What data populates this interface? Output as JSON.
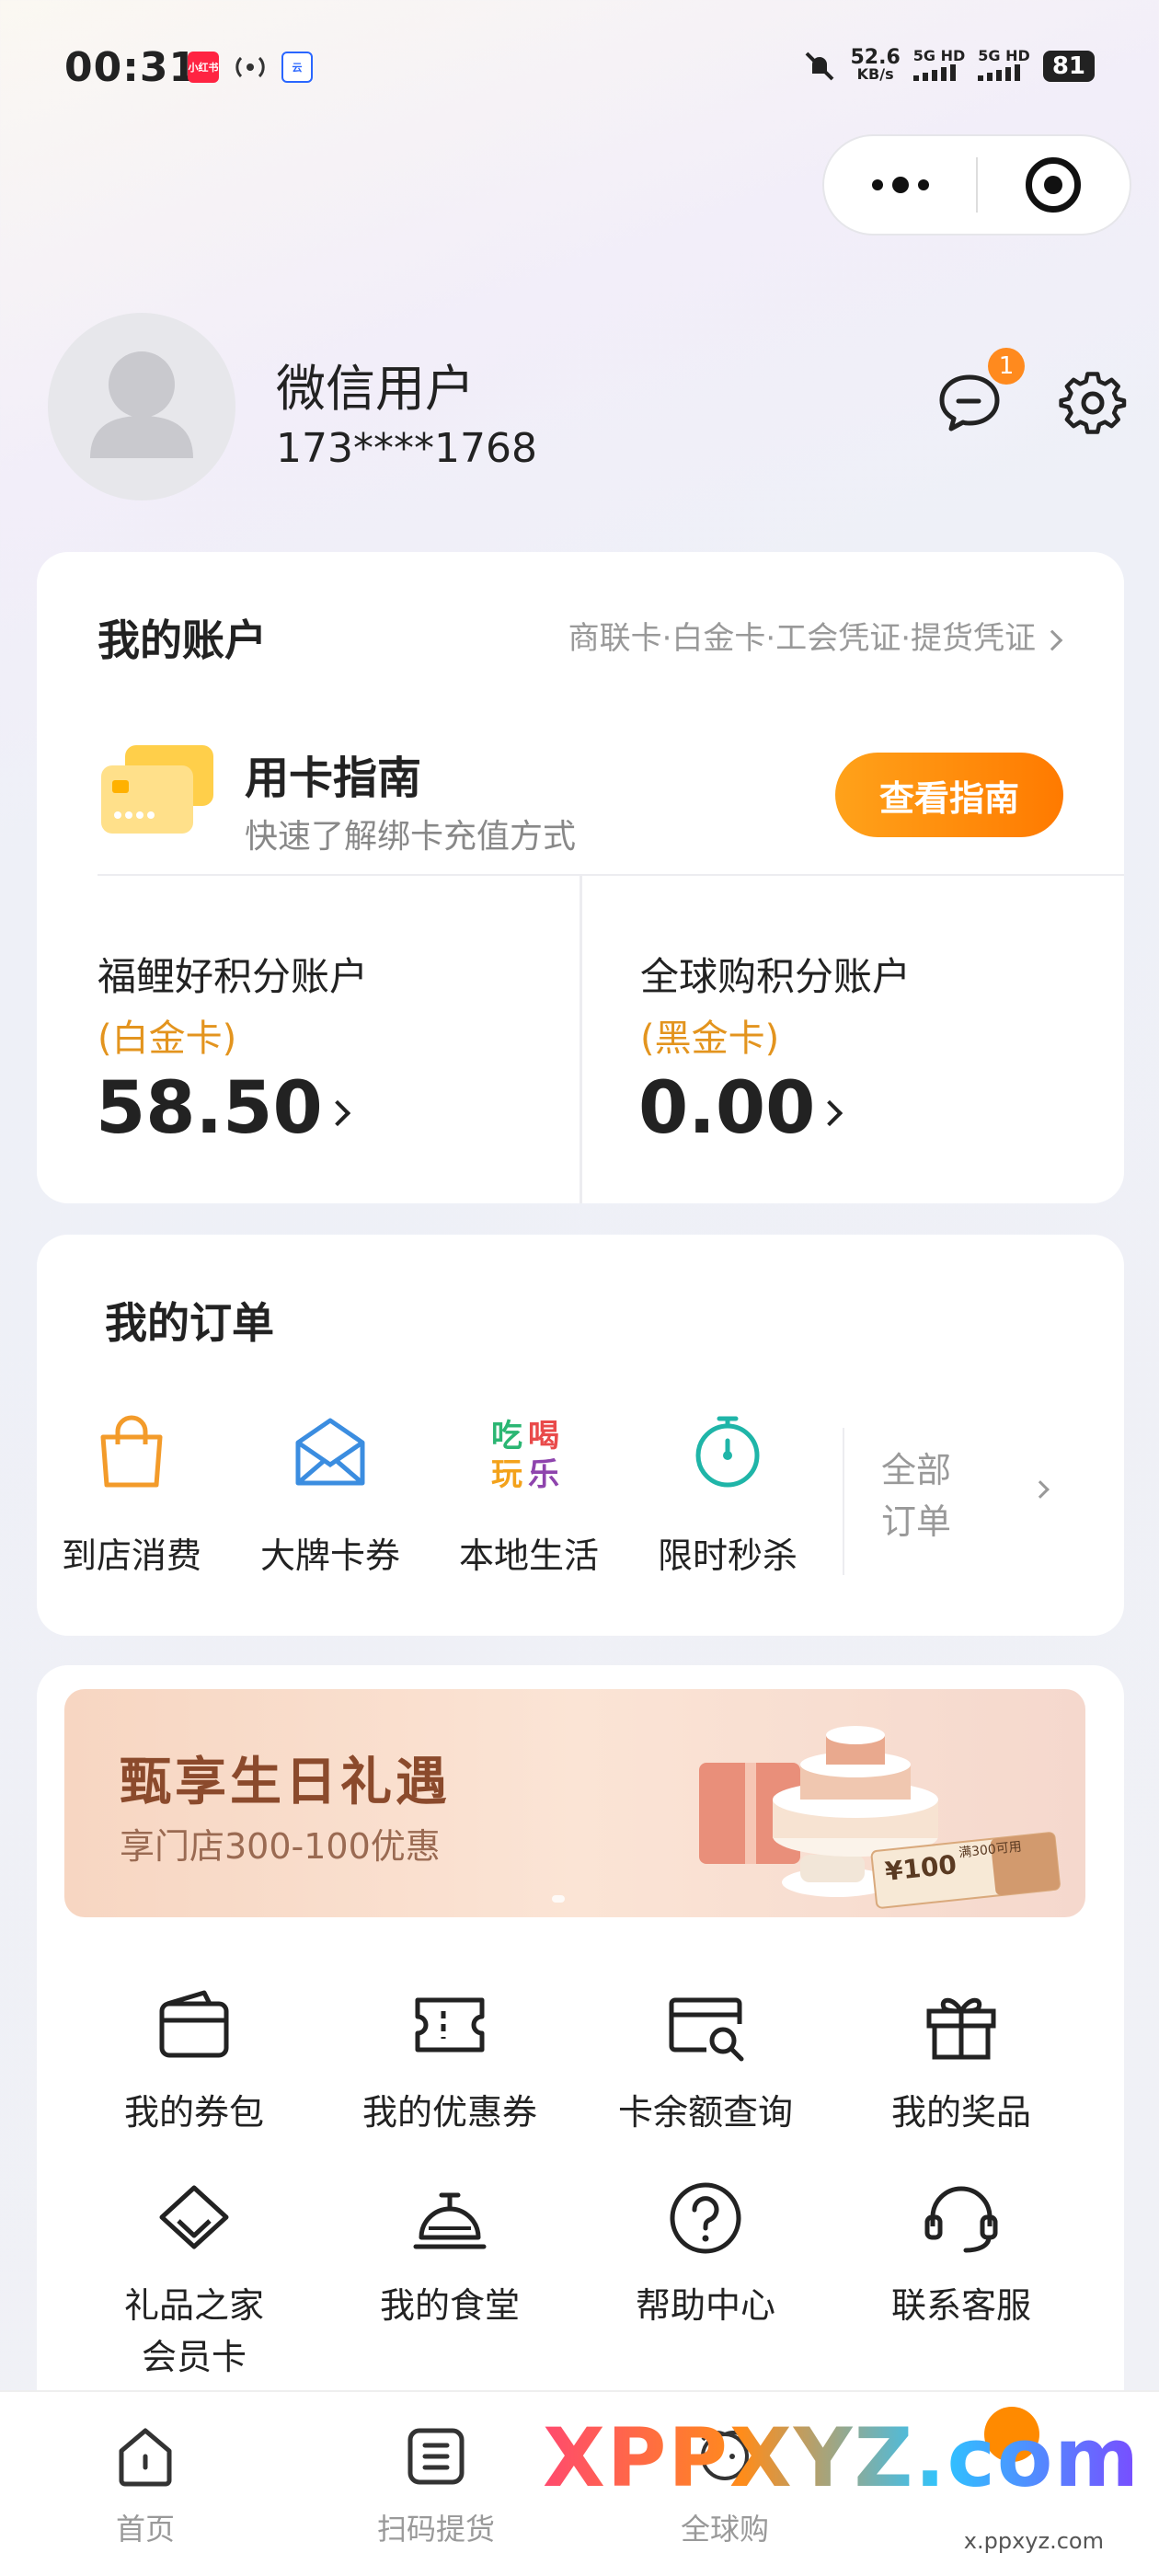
{
  "status_bar": {
    "time": "00:31",
    "app_icon_1": "小红书",
    "app_icon_3": "云",
    "net_speed": "52.6",
    "net_unit": "KB/s",
    "sig1": "5G HD",
    "sig2": "5G HD",
    "battery": "81"
  },
  "profile": {
    "name": "微信用户",
    "phone": "173****1768",
    "message_badge": "1"
  },
  "account": {
    "title": "我的账户",
    "cards_link": "商联卡·白金卡·工会凭证·提货凭证",
    "guide_title": "用卡指南",
    "guide_subtitle": "快速了解绑卡充值方式",
    "guide_button": "查看指南",
    "points": [
      {
        "name": "福鲤好积分账户",
        "tier": "(白金卡)",
        "value": "58.50"
      },
      {
        "name": "全球购积分账户",
        "tier": "(黑金卡)",
        "value": "0.00"
      }
    ]
  },
  "orders": {
    "title": "我的订单",
    "items": [
      "到店消费",
      "大牌卡券",
      "本地生活",
      "限时秒杀"
    ],
    "all_line1": "全部",
    "all_line2": "订单"
  },
  "banner": {
    "title": "甄享生日礼遇",
    "subtitle": "享门店300-100优惠",
    "coupon_value": "¥100",
    "coupon_text": "满300可用"
  },
  "services": [
    {
      "label": "我的券包",
      "icon": "wallet-icon"
    },
    {
      "label": "我的优惠券",
      "icon": "ticket-icon"
    },
    {
      "label": "卡余额查询",
      "icon": "card-search-icon"
    },
    {
      "label": "我的奖品",
      "icon": "gift-icon"
    },
    {
      "label": "礼品之家\n会员卡",
      "icon": "diamond-icon"
    },
    {
      "label": "我的食堂",
      "icon": "cloche-icon"
    },
    {
      "label": "帮助中心",
      "icon": "help-icon"
    },
    {
      "label": "联系客服",
      "icon": "headset-icon"
    }
  ],
  "tabbar": {
    "items": [
      "首页",
      "扫码提货",
      "全球购"
    ]
  },
  "watermark": {
    "main": "XPPXYZ.com",
    "sub": "x.ppxyz.com"
  },
  "colors": {
    "accent_orange": "#ff8a00",
    "tier_gold": "#e3941e"
  }
}
